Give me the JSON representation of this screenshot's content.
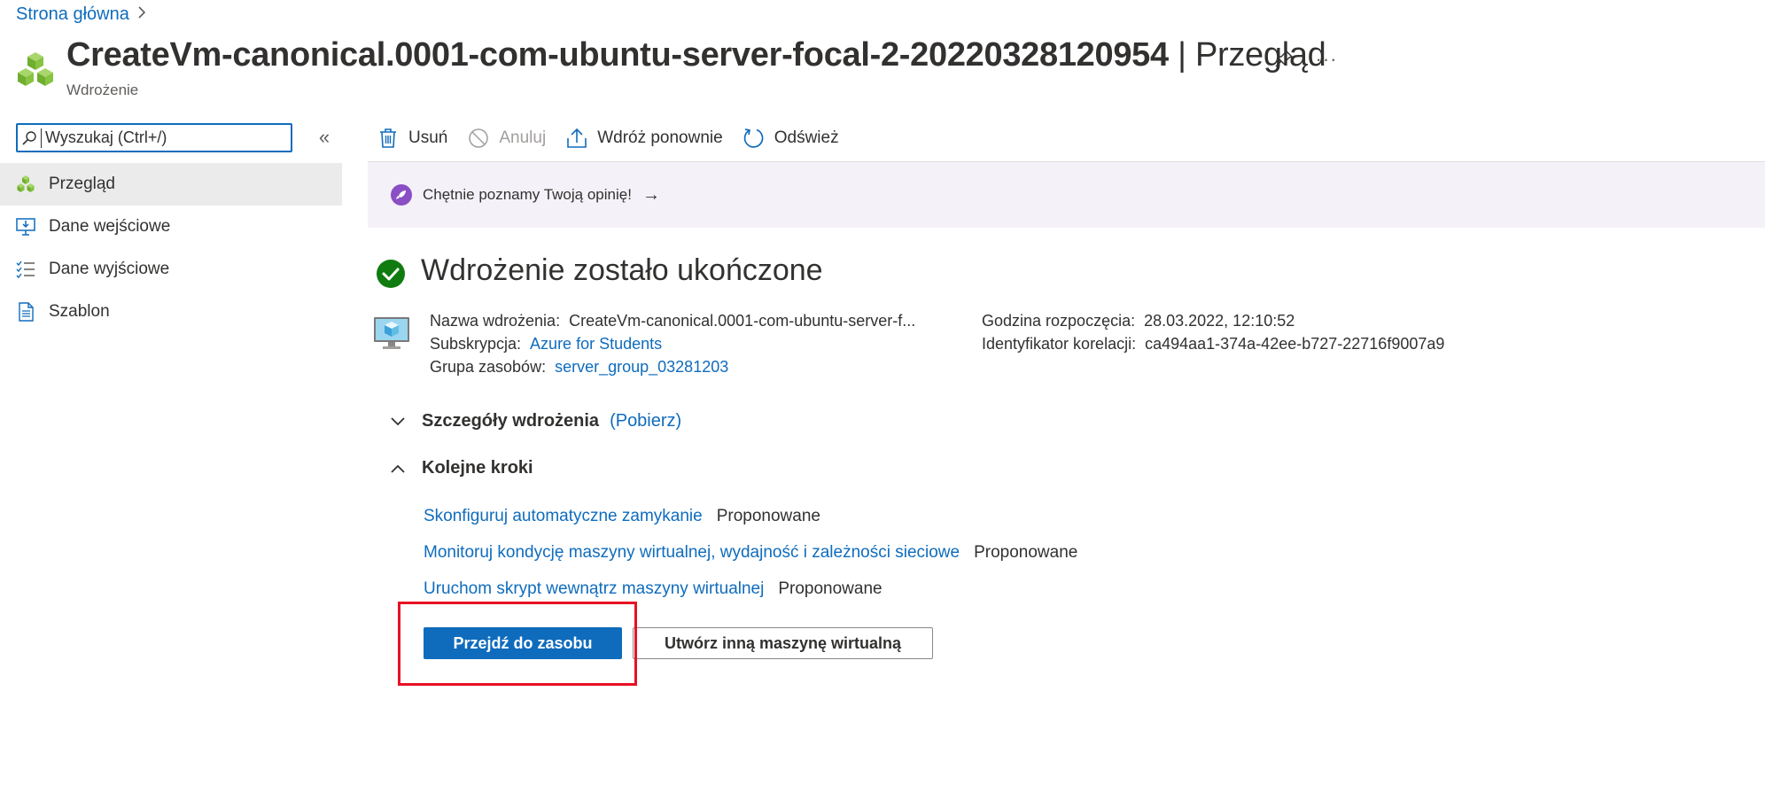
{
  "breadcrumb": {
    "home_label": "Strona główna"
  },
  "header": {
    "title_name": "CreateVm-canonical.0001-com-ubuntu-server-focal-2-20220328120954",
    "title_separator": " | ",
    "title_section": "Przegląd",
    "subtitle": "Wdrożenie",
    "more_label": "···"
  },
  "search": {
    "placeholder": "Wyszukaj (Ctrl+/)",
    "value": ""
  },
  "sidebar": {
    "collapse_label": "«",
    "items": [
      {
        "label": "Przegląd",
        "icon": "cubes-icon",
        "active": true
      },
      {
        "label": "Dane wejściowe",
        "icon": "monitor-download-icon",
        "active": false
      },
      {
        "label": "Dane wyjściowe",
        "icon": "checklist-icon",
        "active": false
      },
      {
        "label": "Szablon",
        "icon": "document-icon",
        "active": false
      }
    ]
  },
  "toolbar": {
    "delete_label": "Usuń",
    "cancel_label": "Anuluj",
    "redeploy_label": "Wdróż ponownie",
    "refresh_label": "Odśwież"
  },
  "feedback": {
    "text": "Chętnie poznamy Twoją opinię!",
    "arrow": "→"
  },
  "status": {
    "title": "Wdrożenie zostało ukończone"
  },
  "details": {
    "name_key": "Nazwa wdrożenia:",
    "name_value": "CreateVm-canonical.0001-com-ubuntu-server-f...",
    "subscription_key": "Subskrypcja:",
    "subscription_value": "Azure for Students",
    "group_key": "Grupa zasobów:",
    "group_value": "server_group_03281203",
    "start_key": "Godzina rozpoczęcia:",
    "start_value": "28.03.2022, 12:10:52",
    "correlation_key": "Identyfikator korelacji:",
    "correlation_value": "ca494aa1-374a-42ee-b727-22716f9007a9"
  },
  "sections": {
    "details_title": "Szczegóły wdrożenia",
    "details_download": "(Pobierz)",
    "next_title": "Kolejne kroki"
  },
  "next_steps": [
    {
      "label": "Skonfiguruj automatyczne zamykanie",
      "status": "Proponowane"
    },
    {
      "label": "Monitoruj kondycję maszyny wirtualnej, wydajność i zależności sieciowe",
      "status": "Proponowane"
    },
    {
      "label": "Uruchom skrypt wewnątrz maszyny wirtualnej",
      "status": "Proponowane"
    }
  ],
  "buttons": {
    "primary_label": "Przejdź do zasobu",
    "secondary_label": "Utwórz inną maszynę wirtualną"
  },
  "colors": {
    "accent": "#0f6cbd",
    "success": "#107c10",
    "highlight": "#e81123",
    "banner_bg": "#f5f1f8",
    "active_nav_bg": "#ebebeb"
  }
}
